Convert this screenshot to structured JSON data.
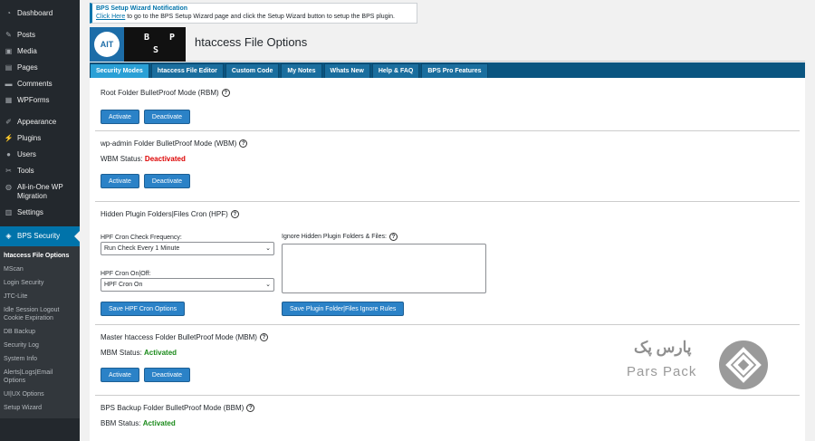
{
  "sidebar": {
    "items": [
      {
        "label": "Dashboard",
        "icon": "dashboard-icon",
        "glyph": "◔"
      },
      {
        "label": "Posts",
        "icon": "pin-icon",
        "glyph": "✎"
      },
      {
        "label": "Media",
        "icon": "media-icon",
        "glyph": "▣"
      },
      {
        "label": "Pages",
        "icon": "page-icon",
        "glyph": "▤"
      },
      {
        "label": "Comments",
        "icon": "comment-icon",
        "glyph": "▬"
      },
      {
        "label": "WPForms",
        "icon": "forms-icon",
        "glyph": "▦"
      },
      {
        "label": "Appearance",
        "icon": "brush-icon",
        "glyph": "✐"
      },
      {
        "label": "Plugins",
        "icon": "plug-icon",
        "glyph": "⚡"
      },
      {
        "label": "Users",
        "icon": "user-icon",
        "glyph": "●"
      },
      {
        "label": "Tools",
        "icon": "wrench-icon",
        "glyph": "✂"
      },
      {
        "label": "All-in-One WP Migration",
        "icon": "migration-icon",
        "glyph": "◍"
      },
      {
        "label": "Settings",
        "icon": "settings-icon",
        "glyph": "▥"
      },
      {
        "label": "BPS Security",
        "icon": "shield-icon",
        "glyph": "◈"
      }
    ],
    "submenu": [
      "htaccess File Options",
      "MScan",
      "Login Security",
      "JTC-Lite",
      "Idle Session Logout Cookie Expiration",
      "DB Backup",
      "Security Log",
      "System Info",
      "Alerts|Logs|Email Options",
      "UI|UX Options",
      "Setup Wizard"
    ]
  },
  "notice": {
    "title": "BPS Setup Wizard Notification",
    "link": "Click Here",
    "text": " to go to the BPS Setup Wizard page and click the Setup Wizard button to setup the BPS plugin."
  },
  "header": {
    "logo_ait": "AIT",
    "logo_bps_top": "B  P",
    "logo_bps_bottom": "S",
    "title": "htaccess File Options"
  },
  "tabs": [
    "Security Modes",
    "htaccess File Editor",
    "Custom Code",
    "My Notes",
    "Whats New",
    "Help & FAQ",
    "BPS Pro Features"
  ],
  "sections": {
    "rbm": {
      "title": "Root Folder BulletProof Mode (RBM)",
      "activate": "Activate",
      "deactivate": "Deactivate"
    },
    "wbm": {
      "title": "wp-admin Folder BulletProof Mode (WBM)",
      "status_label": "WBM Status:",
      "status_value": "Deactivated",
      "activate": "Activate",
      "deactivate": "Deactivate"
    },
    "hpf": {
      "title": "Hidden Plugin Folders|Files Cron (HPF)",
      "freq_label": "HPF Cron Check Frequency:",
      "freq_value": "Run Check Every 1 Minute",
      "onoff_label": "HPF Cron On|Off:",
      "onoff_value": "HPF Cron On",
      "ignore_label": "Ignore Hidden Plugin Folders & Files:",
      "save_options": "Save HPF Cron Options",
      "save_ignore": "Save Plugin Folder|Files Ignore Rules"
    },
    "mbm": {
      "title": "Master htaccess Folder BulletProof Mode (MBM)",
      "status_label": "MBM Status:",
      "status_value": "Activated",
      "activate": "Activate",
      "deactivate": "Deactivate"
    },
    "bbm": {
      "title": "BPS Backup Folder BulletProof Mode (BBM)",
      "status_label": "BBM Status:",
      "status_value": "Activated"
    }
  },
  "help_glyph": "?",
  "watermark": {
    "fa": "پارس پک",
    "en": "Pars Pack"
  },
  "colors": {
    "accent": "#0073aa",
    "tab_bar": "#0a5580",
    "active_tab": "#2aa0d6",
    "button": "#2b82c7",
    "deactivated": "#dd0000",
    "activated": "#1a8a1a"
  }
}
